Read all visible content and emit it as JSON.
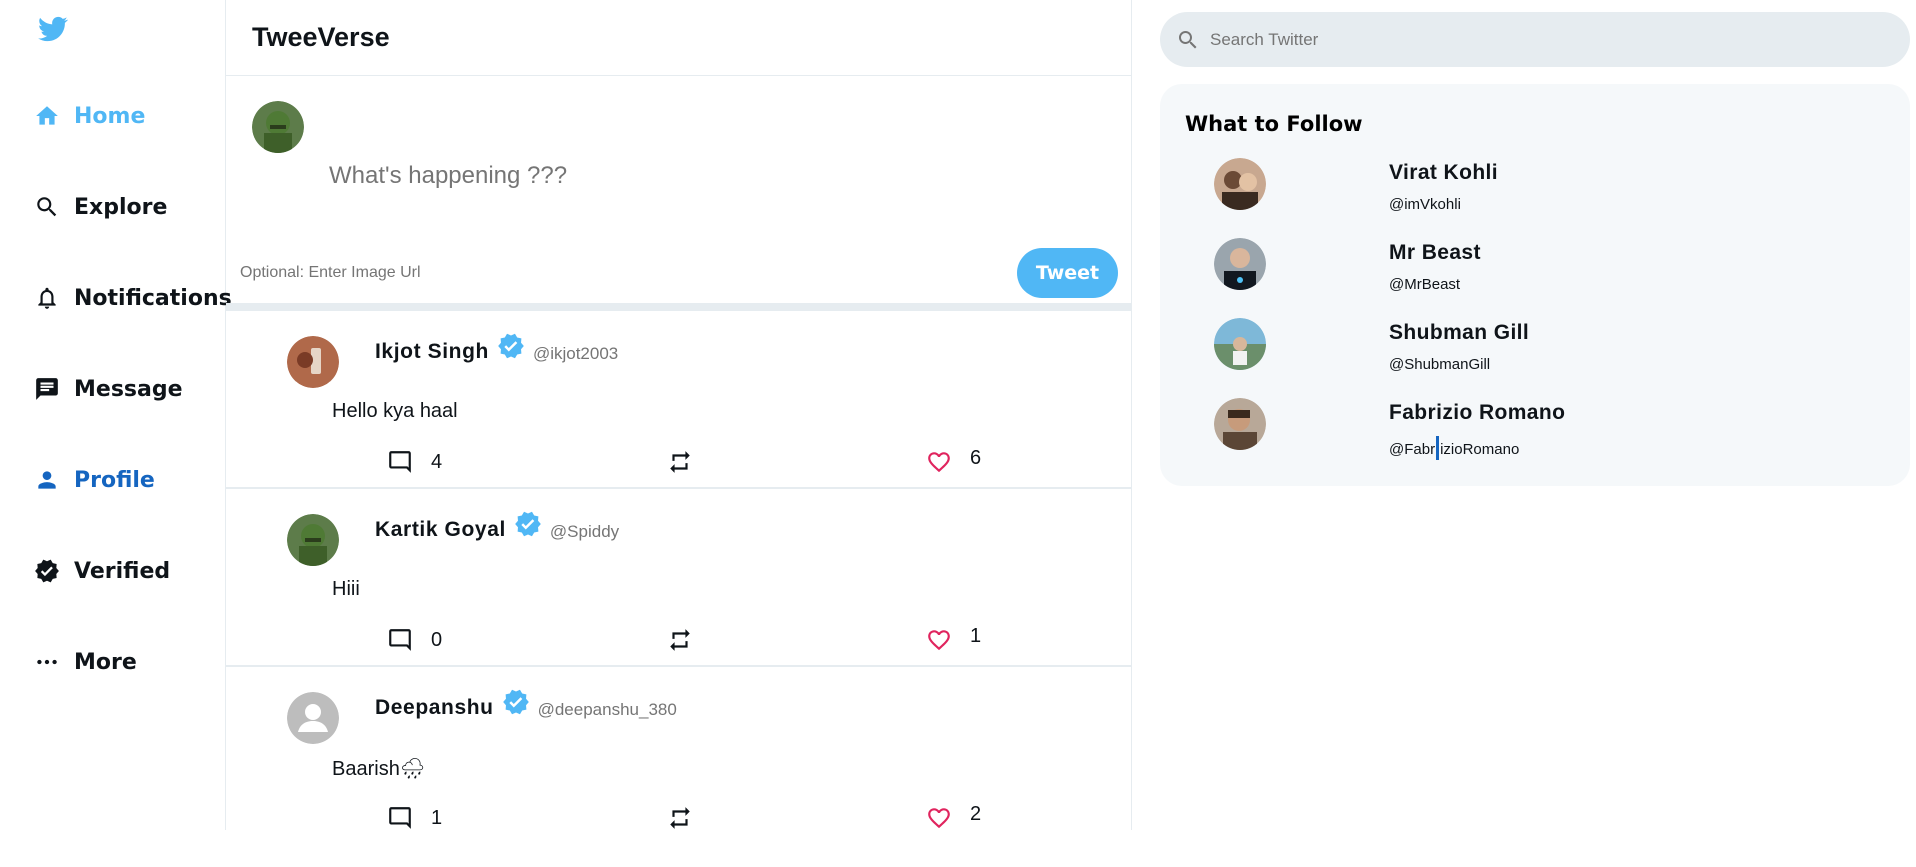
{
  "app": {
    "title": "TweeVerse"
  },
  "colors": {
    "accent": "#50b7f5",
    "like": "#e0245e",
    "profile": "#1565c0"
  },
  "sidebar": {
    "logo": "twitter-bird-icon",
    "items": [
      {
        "label": "Home",
        "icon": "home-icon",
        "active": true
      },
      {
        "label": "Explore",
        "icon": "search-icon"
      },
      {
        "label": "Notifications",
        "icon": "bell-icon"
      },
      {
        "label": "Message",
        "icon": "message-icon"
      },
      {
        "label": "Profile",
        "icon": "person-icon"
      },
      {
        "label": "Verified",
        "icon": "verified-badge-icon"
      },
      {
        "label": "More",
        "icon": "more-dots-icon"
      }
    ]
  },
  "tweetbox": {
    "placeholder": "What's happening ???",
    "image_placeholder": "Optional: Enter Image Url",
    "tweet_label": "Tweet"
  },
  "posts": [
    {
      "name": "Ikjot Singh",
      "handle": "@ikjot2003",
      "text": "Hello kya haal",
      "comments": "4",
      "likes": "6"
    },
    {
      "name": "Kartik Goyal",
      "handle": "@Spiddy",
      "text": "Hiii",
      "comments": "0",
      "likes": "1"
    },
    {
      "name": "Deepanshu",
      "handle": "@deepanshu_380",
      "text": "Baarish🌧",
      "comments": "1",
      "likes": "2"
    }
  ],
  "widgets": {
    "search_placeholder": "Search Twitter",
    "follow_title": "What to Follow",
    "follow": [
      {
        "name": "Virat Kohli",
        "handle": "@imVkohli"
      },
      {
        "name": "Mr Beast",
        "handle": "@MrBeast"
      },
      {
        "name": "Shubman Gill",
        "handle": "@ShubmanGill"
      },
      {
        "name": "Fabrizio Romano",
        "handle_start": "@Fabr",
        "handle_end": "izioRomano"
      }
    ]
  }
}
